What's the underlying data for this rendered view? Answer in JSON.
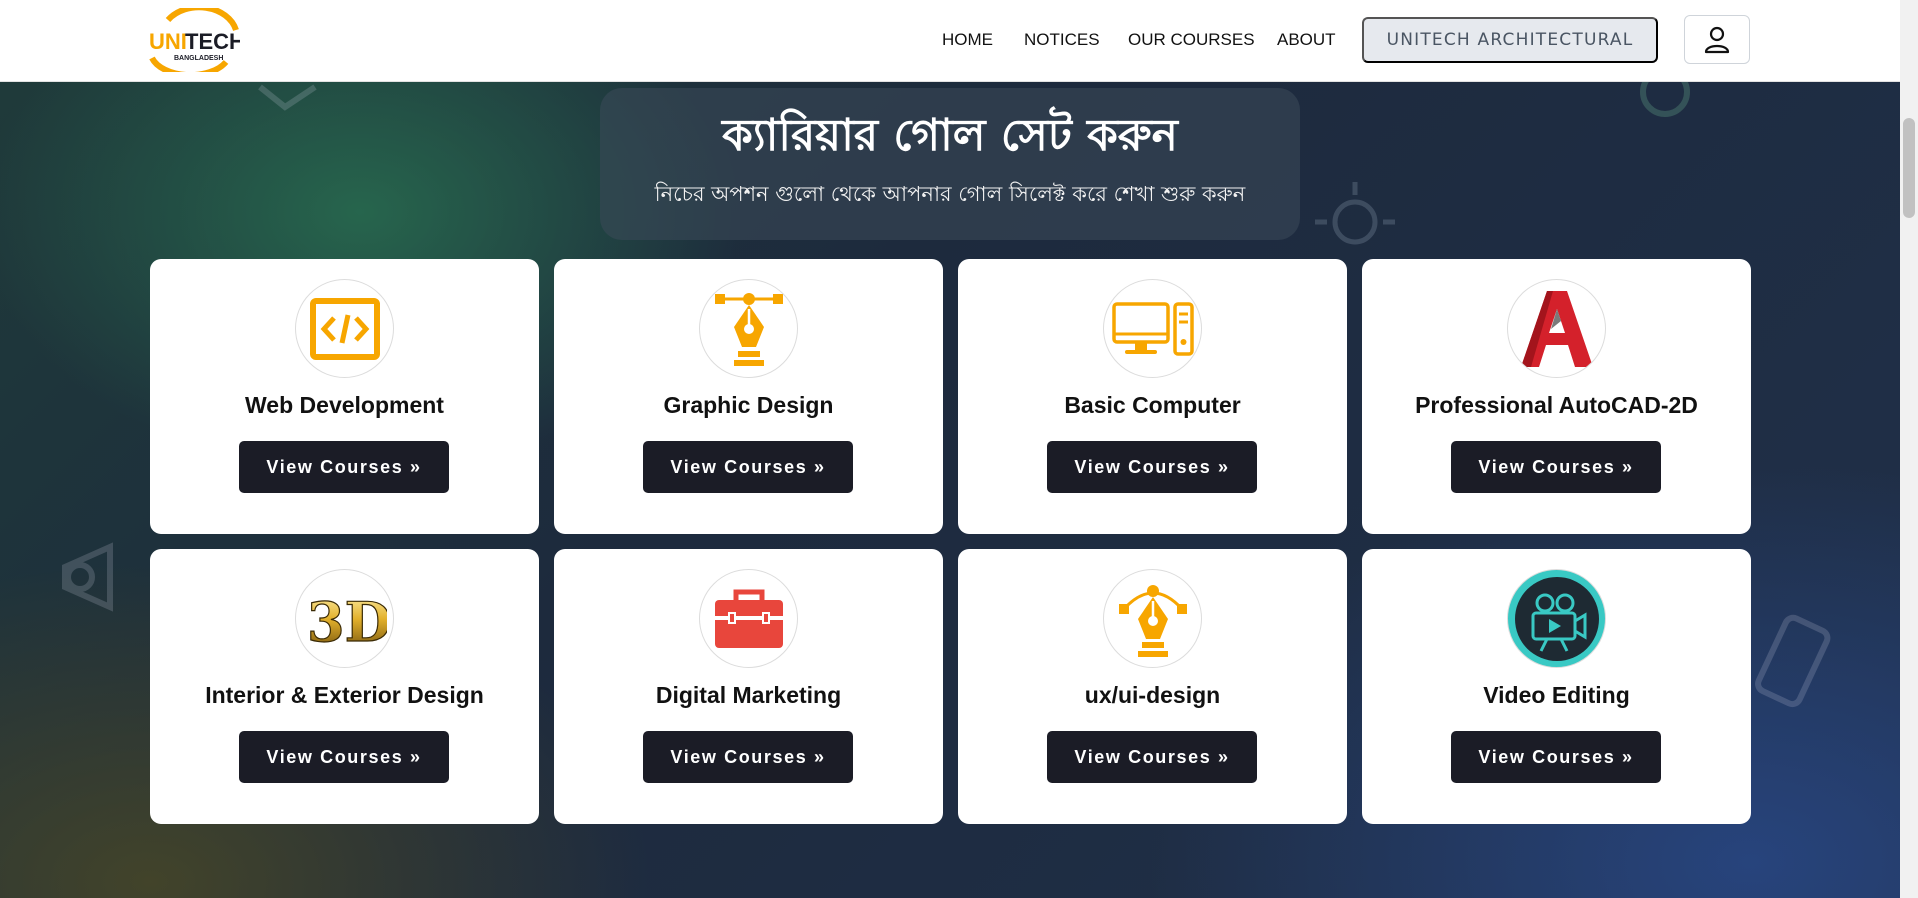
{
  "header": {
    "logo_text": "UNITECH",
    "logo_subtext": "BANGLADESH",
    "nav": [
      "HOME",
      "NOTICES",
      "OUR COURSES",
      "ABOUT"
    ],
    "architectural_button": "UNITECH ARCHITECTURAL",
    "user_icon": "user-icon"
  },
  "hero": {
    "title": "ক্যারিয়ার গোল সেট করুন",
    "subtitle": "নিচের অপশন গুলো থেকে আপনার গোল সিলেক্ট করে শেখা শুরু করুন"
  },
  "courses": [
    {
      "title": "Web Development",
      "button": "View Courses »",
      "icon": "code-icon"
    },
    {
      "title": "Graphic Design",
      "button": "View Courses »",
      "icon": "pen-tool-icon"
    },
    {
      "title": "Basic Computer",
      "button": "View Courses »",
      "icon": "desktop-computer-icon"
    },
    {
      "title": "Professional AutoCAD-2D",
      "button": "View Courses »",
      "icon": "autocad-logo-icon"
    },
    {
      "title": "Interior & Exterior Design",
      "button": "View Courses »",
      "icon": "3d-icon"
    },
    {
      "title": "Digital Marketing",
      "button": "View Courses »",
      "icon": "toolbox-icon"
    },
    {
      "title": "ux/ui-design",
      "button": "View Courses »",
      "icon": "pen-tool-icon"
    },
    {
      "title": "Video Editing",
      "button": "View Courses »",
      "icon": "video-camera-icon"
    }
  ],
  "colors": {
    "accent_orange": "#f7a600",
    "button_dark": "#1b1c26",
    "red": "#e8463c",
    "teal": "#39c9c4"
  }
}
